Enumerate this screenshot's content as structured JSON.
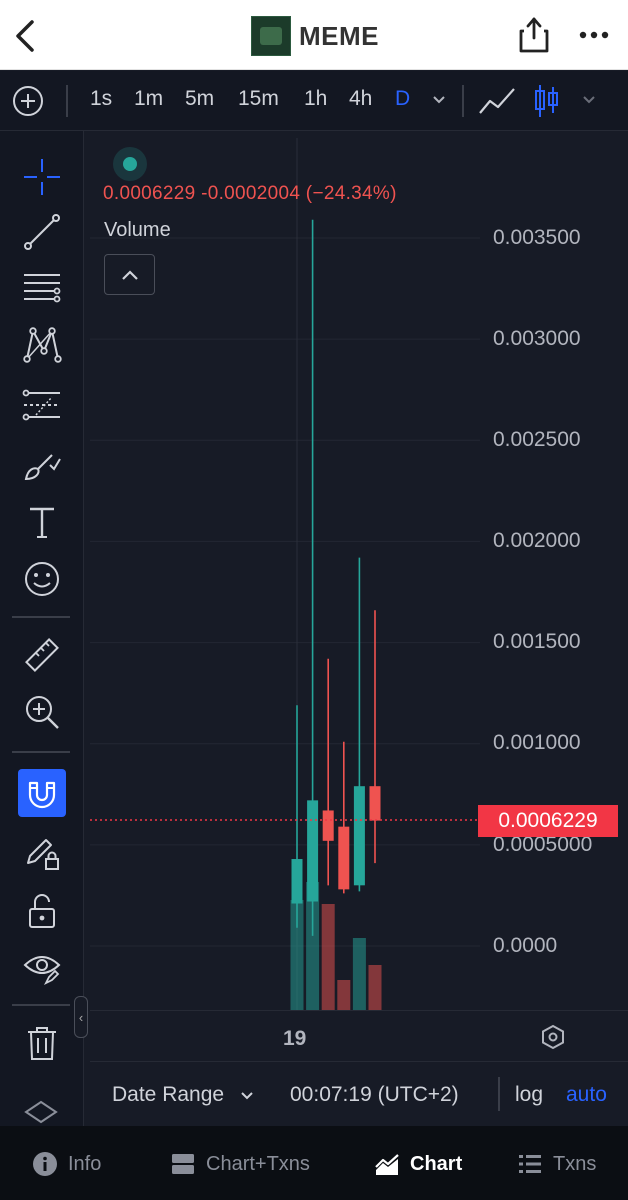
{
  "header": {
    "title": "MEME"
  },
  "toolbar": {
    "timeframes": [
      "1s",
      "1m",
      "5m",
      "15m",
      "1h",
      "4h",
      "D"
    ],
    "active_timeframe": "D"
  },
  "legend": {
    "ohlc": "0.0006229  -0.0002004 (−24.34%)",
    "volume_label": "Volume"
  },
  "price_axis": {
    "labels": [
      "0.003500",
      "0.003000",
      "0.002500",
      "0.002000",
      "0.001500",
      "0.001000",
      "0.0005000",
      "0.0000"
    ],
    "current_price": "0.0006229"
  },
  "time_axis": {
    "tick": "19"
  },
  "footer": {
    "date_range": "Date Range",
    "time": "00:07:19 (UTC+2)",
    "log": "log",
    "auto": "auto"
  },
  "bottom_nav": {
    "items": [
      "Info",
      "Chart+Txns",
      "Chart",
      "Txns"
    ],
    "active": "Chart"
  },
  "colors": {
    "up": "#26a69a",
    "down": "#ef5350",
    "accent": "#2962ff"
  },
  "chart_data": {
    "type": "candlestick",
    "ylim": [
      0,
      0.0037
    ],
    "candles": [
      {
        "open": 0.00021,
        "high": 0.00119,
        "low": 9e-05,
        "close": 0.00043,
        "volume": 0.0
      },
      {
        "open": 0.00022,
        "high": 0.00359,
        "low": 5e-05,
        "close": 0.00072,
        "volume": 0.0
      },
      {
        "open": 0.00067,
        "high": 0.00142,
        "low": 0.0003,
        "close": 0.00052,
        "volume": 0.0
      },
      {
        "open": 0.00059,
        "high": 0.00101,
        "low": 0.00026,
        "close": 0.00028,
        "volume": 0.0
      },
      {
        "open": 0.0003,
        "high": 0.00192,
        "low": 0.00027,
        "close": 0.00079,
        "volume": 0.0
      },
      {
        "open": 0.00079,
        "high": 0.00166,
        "low": 0.00041,
        "close": 0.00062,
        "volume": 0.0
      }
    ],
    "current_price": 0.0006229
  }
}
